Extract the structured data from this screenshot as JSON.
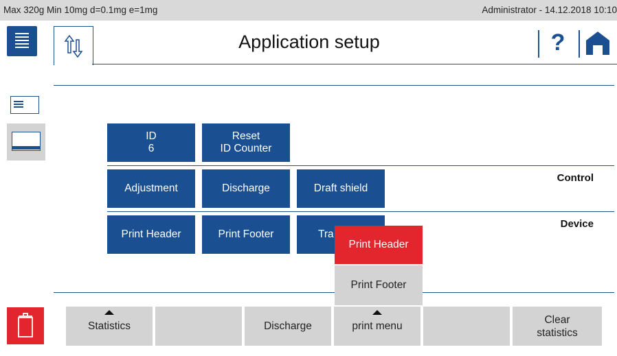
{
  "status_bar": {
    "left_text": "Max 320g  Min 10mg  d=0.1mg  e=1mg",
    "right_text": "Administrator  -  14.12.2018 10:10"
  },
  "header": {
    "title": "Application setup",
    "help_glyph": "?"
  },
  "buttons": {
    "id": {
      "line1": "ID",
      "line2": "6"
    },
    "reset": {
      "line1": "Reset",
      "line2": "ID Counter"
    },
    "adjustment": "Adjustment",
    "discharge": "Discharge",
    "draft_shield": "Draft shield",
    "print_header": "Print Header",
    "print_footer": "Print Footer",
    "tra_partial": "Tra"
  },
  "sections": {
    "control": "Control",
    "device": "Device"
  },
  "popup": {
    "selected": "Print Header",
    "other": "Print Footer"
  },
  "softkeys": [
    {
      "label": "Statistics",
      "has_arrow": true
    },
    {
      "label": "",
      "has_arrow": false
    },
    {
      "label": "Discharge",
      "has_arrow": false
    },
    {
      "label": "print menu",
      "has_arrow": true
    },
    {
      "label": "",
      "has_arrow": false
    },
    {
      "label": "Clear\nstatistics",
      "has_arrow": false
    }
  ],
  "colors": {
    "primary": "#1a4f91",
    "accent_red": "#e3262d",
    "softkey_gray": "#d3d3d3",
    "status_gray": "#d9d9d9"
  },
  "icons": {
    "menu": "menu-list-icon",
    "tab": "up-down-arrows-icon",
    "help": "help-icon",
    "home": "home-icon",
    "trash": "trash-icon",
    "view_list": "list-view-icon",
    "view_panel": "panel-view-icon"
  }
}
